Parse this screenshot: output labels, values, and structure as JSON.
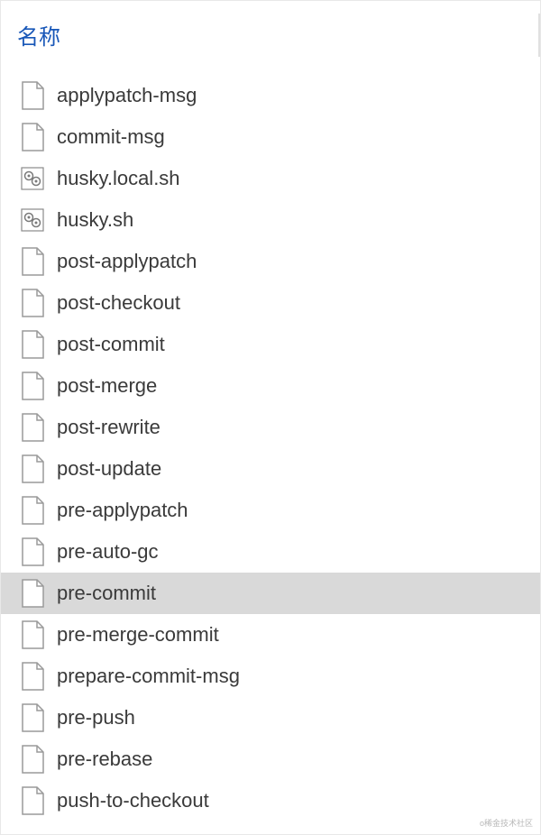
{
  "header": {
    "column_label": "名称"
  },
  "files": [
    {
      "name": "applypatch-msg",
      "icon": "file",
      "selected": false
    },
    {
      "name": "commit-msg",
      "icon": "file",
      "selected": false
    },
    {
      "name": "husky.local.sh",
      "icon": "sh",
      "selected": false
    },
    {
      "name": "husky.sh",
      "icon": "sh",
      "selected": false
    },
    {
      "name": "post-applypatch",
      "icon": "file",
      "selected": false
    },
    {
      "name": "post-checkout",
      "icon": "file",
      "selected": false
    },
    {
      "name": "post-commit",
      "icon": "file",
      "selected": false
    },
    {
      "name": "post-merge",
      "icon": "file",
      "selected": false
    },
    {
      "name": "post-rewrite",
      "icon": "file",
      "selected": false
    },
    {
      "name": "post-update",
      "icon": "file",
      "selected": false
    },
    {
      "name": "pre-applypatch",
      "icon": "file",
      "selected": false
    },
    {
      "name": "pre-auto-gc",
      "icon": "file",
      "selected": false
    },
    {
      "name": "pre-commit",
      "icon": "file",
      "selected": true
    },
    {
      "name": "pre-merge-commit",
      "icon": "file",
      "selected": false
    },
    {
      "name": "prepare-commit-msg",
      "icon": "file",
      "selected": false
    },
    {
      "name": "pre-push",
      "icon": "file",
      "selected": false
    },
    {
      "name": "pre-rebase",
      "icon": "file",
      "selected": false
    },
    {
      "name": "push-to-checkout",
      "icon": "file",
      "selected": false
    }
  ],
  "watermark": "o稀金技术社区"
}
